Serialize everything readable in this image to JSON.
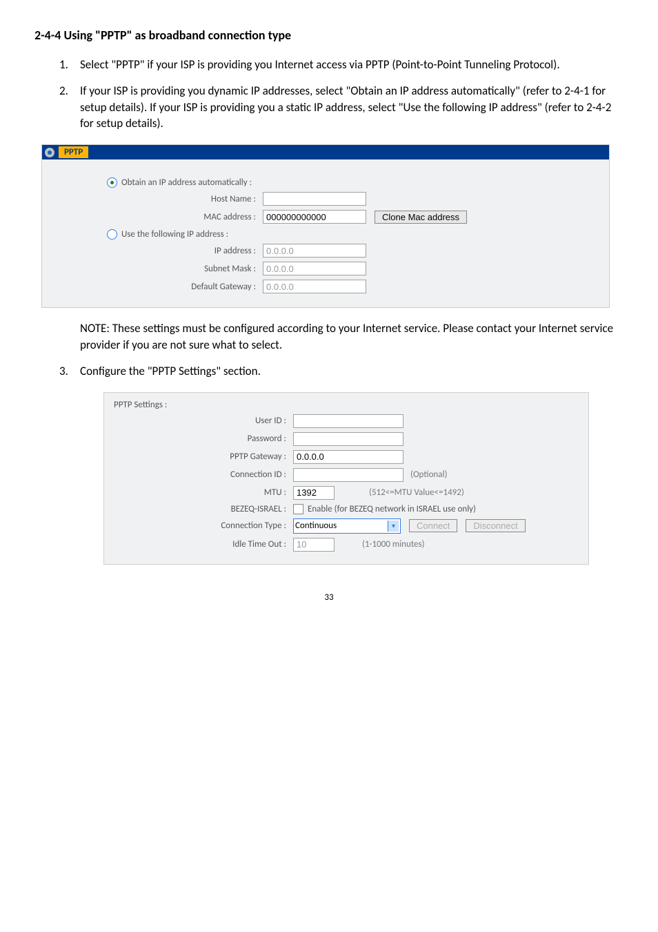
{
  "heading": "2-4-4 Using \"PPTP\" as broadband connection type",
  "list": {
    "item1_num": "1.",
    "item1_text": "Select \"PPTP\" if your ISP is providing you Internet access via PPTP (Point-to-Point Tunneling Protocol).",
    "item2_num": "2.",
    "item2_text": "If your ISP is providing you dynamic IP addresses, select \"Obtain an IP address automatically\" (refer to 2-4-1 for setup details). If your ISP is providing you a static IP address, select \"Use the following IP address\" (refer to 2-4-2 for setup details).",
    "item3_num": "3.",
    "item3_text": "Configure the \"PPTP Settings\" section."
  },
  "panel1": {
    "title": "PPTP",
    "radio_auto": "Obtain an IP address automatically :",
    "host_name_label": "Host Name :",
    "host_name_value": "",
    "mac_label": "MAC address :",
    "mac_value": "000000000000",
    "clone_btn": "Clone Mac address",
    "radio_static": "Use the following IP address :",
    "ip_label": "IP address :",
    "ip_value": "0.0.0.0",
    "subnet_label": "Subnet Mask :",
    "subnet_value": "0.0.0.0",
    "gateway_label": "Default Gateway :",
    "gateway_value": "0.0.0.0"
  },
  "note_text": "NOTE: These settings must be configured according to your Internet service. Please contact your Internet service provider if you are not sure what to select.",
  "panel2": {
    "title": "PPTP Settings :",
    "userid_label": "User ID :",
    "userid_value": "",
    "password_label": "Password :",
    "password_value": "",
    "gateway_label": "PPTP Gateway :",
    "gateway_value": "0.0.0.0",
    "connid_label": "Connection ID :",
    "connid_value": "",
    "connid_note": "(Optional)",
    "mtu_label": "MTU :",
    "mtu_value": "1392",
    "mtu_note": "(512<=MTU Value<=1492)",
    "bezeq_label": "BEZEQ-ISRAEL :",
    "bezeq_text": "Enable (for BEZEQ network in ISRAEL use only)",
    "conntype_label": "Connection Type :",
    "conntype_value": "Continuous",
    "connect_btn": "Connect",
    "disconnect_btn": "Disconnect",
    "idle_label": "Idle Time Out :",
    "idle_value": "10",
    "idle_note": "(1-1000 minutes)"
  },
  "page_number": "33"
}
